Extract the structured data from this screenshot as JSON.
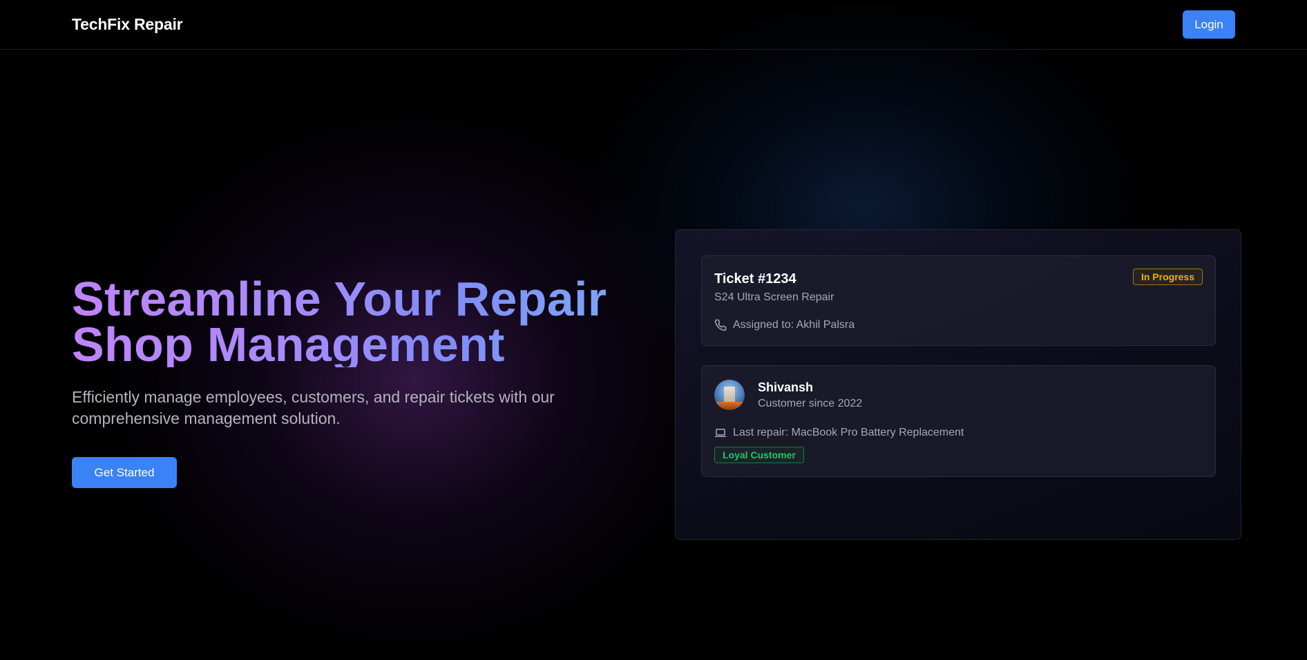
{
  "header": {
    "brand": "TechFix Repair",
    "login_label": "Login"
  },
  "hero": {
    "title_line1": "Streamline Your Repair",
    "title_line2": "Shop Management",
    "subtitle_line1": "Efficiently manage employees, customers, and repair tickets with our",
    "subtitle_line2": "comprehensive management solution.",
    "cta_label": "Get Started"
  },
  "ticket": {
    "title": "Ticket #1234",
    "device": "S24 Ultra Screen Repair",
    "status": "In Progress",
    "status_color": "#eab308",
    "assigned": "Assigned to: Akhil Palsra",
    "icon": "phone-icon"
  },
  "customer": {
    "name": "Shivansh",
    "since": "Customer since 2022",
    "last_repair": "Last repair: MacBook Pro Battery Replacement",
    "badge": "Loyal Customer",
    "badge_color": "#22c55e",
    "icon": "laptop-icon"
  },
  "colors": {
    "accent": "#3b82f6",
    "gradient_start": "#c084fc",
    "gradient_end": "#7ea4f6"
  }
}
